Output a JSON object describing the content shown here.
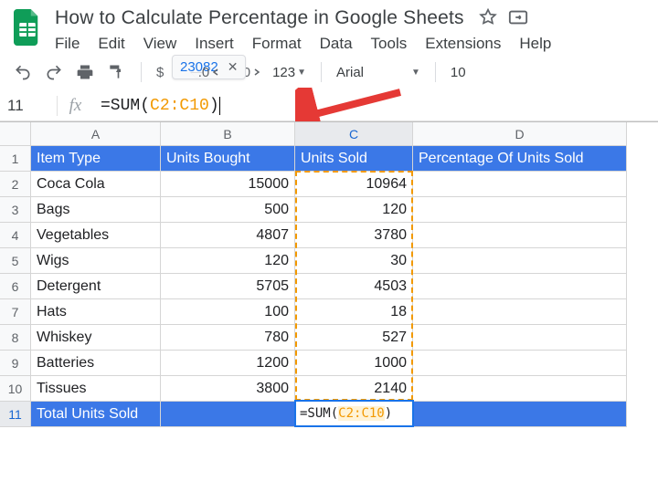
{
  "doc_title": "How to Calculate Percentage in Google Sheets",
  "menus": {
    "file": "File",
    "edit": "Edit",
    "view": "View",
    "insert": "Insert",
    "format": "Format",
    "data": "Data",
    "tools": "Tools",
    "extensions": "Extensions",
    "help": "Help"
  },
  "toolbar": {
    "currency": "$",
    "percent": "%",
    "dec_less": ".0",
    "dec_more": ".00",
    "fmt_123": "123",
    "font_name": "Arial",
    "font_size": "10",
    "autocomplete_value": "23082"
  },
  "name_box": "11",
  "formula": {
    "fn": "=SUM",
    "open": "(",
    "range": "C2:C10",
    "close": ")"
  },
  "columns": [
    "A",
    "B",
    "C",
    "D"
  ],
  "headers": {
    "A": "Item Type",
    "B": "Units Bought",
    "C": "Units Sold",
    "D": "Percentage Of Units Sold"
  },
  "rows": [
    {
      "A": "Coca Cola",
      "B": "15000",
      "C": "10964",
      "D": ""
    },
    {
      "A": "Bags",
      "B": "500",
      "C": "120",
      "D": ""
    },
    {
      "A": "Vegetables",
      "B": "4807",
      "C": "3780",
      "D": ""
    },
    {
      "A": "Wigs",
      "B": "120",
      "C": "30",
      "D": ""
    },
    {
      "A": "Detergent",
      "B": "5705",
      "C": "4503",
      "D": ""
    },
    {
      "A": "Hats",
      "B": "100",
      "C": "18",
      "D": ""
    },
    {
      "A": "Whiskey",
      "B": "780",
      "C": "527",
      "D": ""
    },
    {
      "A": "Batteries",
      "B": "1200",
      "C": "1000",
      "D": ""
    },
    {
      "A": "Tissues",
      "B": "3800",
      "C": "2140",
      "D": ""
    }
  ],
  "total_row_label": "Total Units Sold"
}
